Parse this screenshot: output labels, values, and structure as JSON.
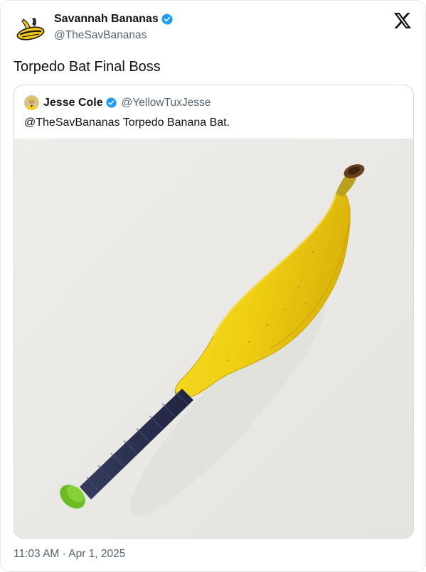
{
  "tweet": {
    "author": {
      "display_name": "Savannah Bananas",
      "handle": "@TheSavBananas",
      "verified": true,
      "avatar_icon": "savannah-bananas-logo-icon"
    },
    "text": "Torpedo Bat Final Boss",
    "timestamp": "11:03 AM · Apr 1, 2025",
    "brand_icon": "x-logo-icon"
  },
  "quote": {
    "author": {
      "display_name": "Jesse Cole",
      "handle": "@YellowTuxJesse",
      "verified": true,
      "avatar_icon": "jesse-cole-avatar-icon"
    },
    "text": "@TheSavBananas Torpedo Banana Bat.",
    "media": {
      "subject": "banana-bat-image",
      "colors": {
        "background": "#ebeae7",
        "banana": "#f2d116",
        "grip": "#2a3050",
        "knob": "#74c22a"
      }
    }
  },
  "colors": {
    "verified_blue": "#1d9bf0",
    "text_primary": "#0f1419",
    "text_secondary": "#536471",
    "border": "#cfd9de"
  }
}
